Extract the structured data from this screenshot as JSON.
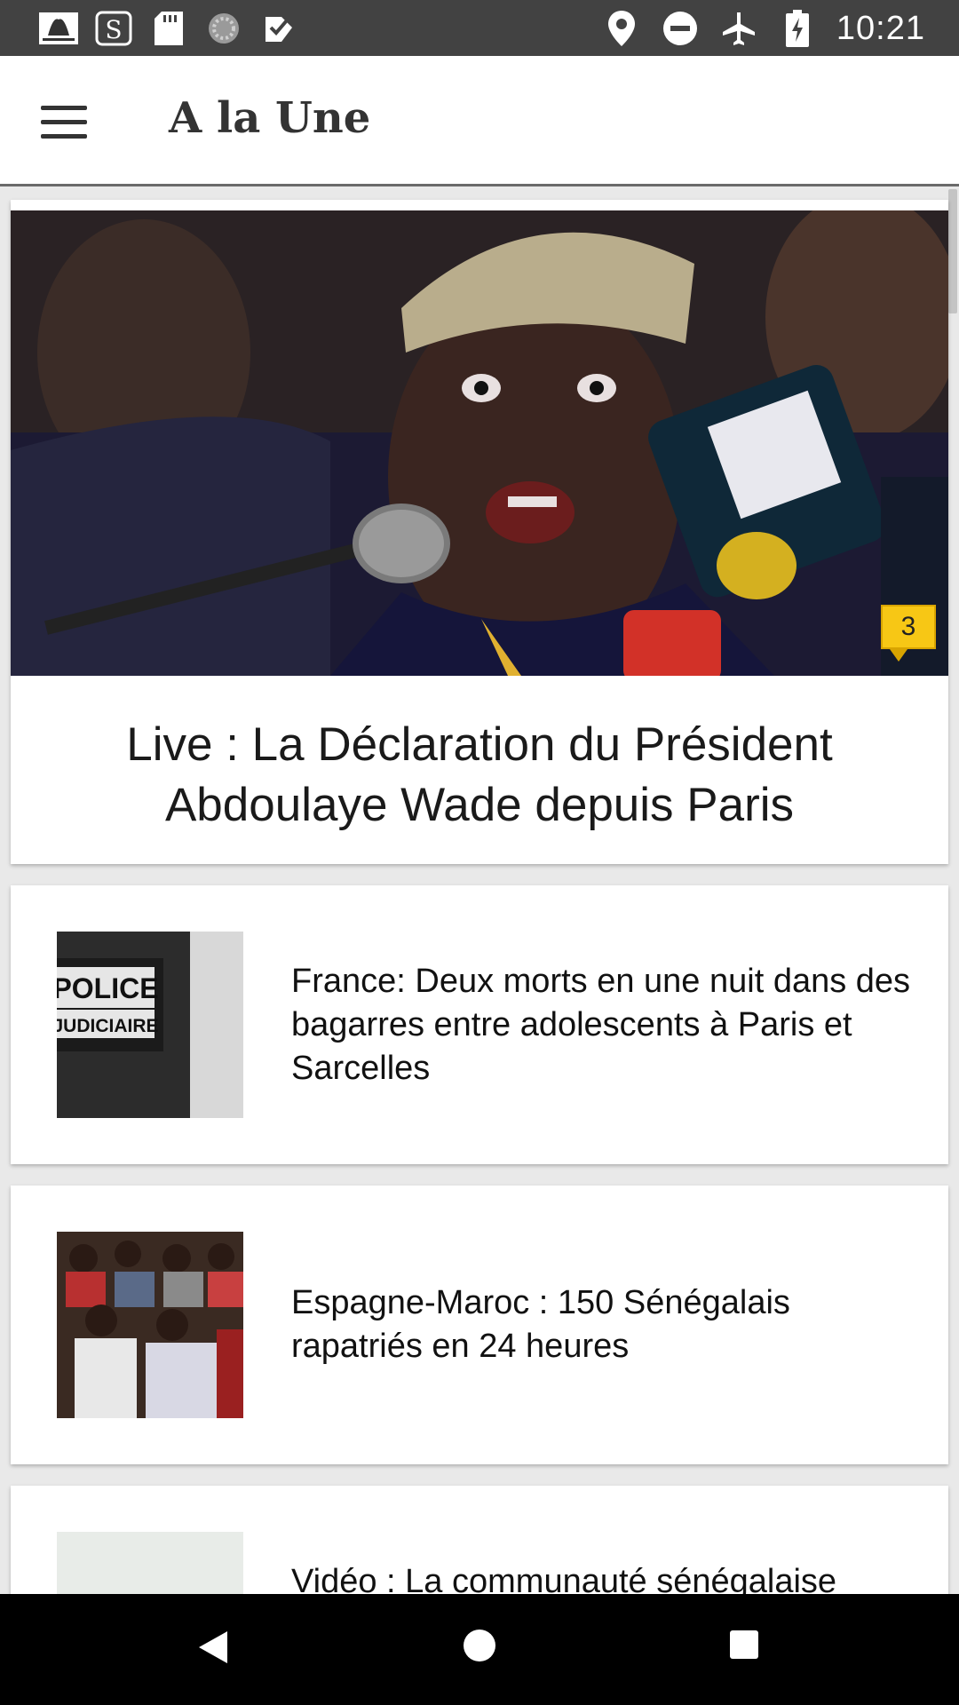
{
  "status_bar": {
    "time": "10:21",
    "left_icons": [
      "newspaper-logo-icon",
      "s-app-icon",
      "sd-card-icon",
      "loading-circle-icon",
      "checklist-icon"
    ],
    "right_icons": [
      "location-icon",
      "do-not-disturb-icon",
      "airplane-mode-icon",
      "battery-charging-icon"
    ]
  },
  "app_bar": {
    "title": "A la Une",
    "menu_icon": "hamburger-menu-icon"
  },
  "hero": {
    "title": "Live : La Déclaration du Président Abdoulaye Wade depuis Paris",
    "comment_count": "3"
  },
  "articles": [
    {
      "title": "France: Deux morts en une nuit dans des bagarres entre adolescents à Paris et Sarcelles",
      "thumb_text_1": "POLICE",
      "thumb_text_2": "JUDICIAIRE"
    },
    {
      "title": "Espagne-Maroc : 150 Sénégalais rapatriés en 24 heures"
    },
    {
      "title": "Vidéo : La communauté sénégalaise"
    }
  ],
  "colors": {
    "status_bar": "#424242",
    "app_bar": "#ffffff",
    "badge": "#f7c715",
    "nav_bar": "#000000"
  }
}
